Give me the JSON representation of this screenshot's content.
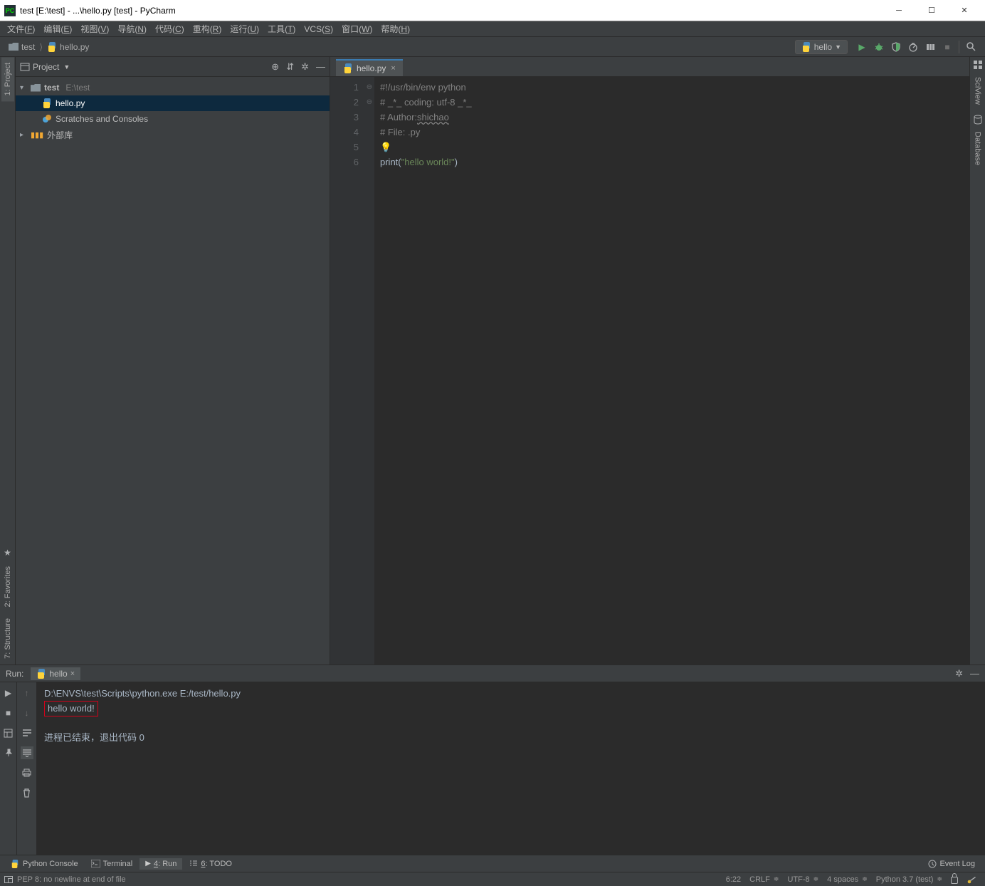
{
  "window": {
    "title": "test [E:\\test] - ...\\hello.py [test] - PyCharm"
  },
  "menubar": [
    "文件(F)",
    "编辑(E)",
    "视图(V)",
    "导航(N)",
    "代码(C)",
    "重构(R)",
    "运行(U)",
    "工具(T)",
    "VCS(S)",
    "窗口(W)",
    "帮助(H)"
  ],
  "breadcrumb": [
    {
      "icon": "folder",
      "label": "test"
    },
    {
      "icon": "python",
      "label": "hello.py"
    }
  ],
  "run_config": {
    "name": "hello"
  },
  "left_tabs": {
    "project": "1: Project"
  },
  "right_tabs": {
    "sciview": "SciView",
    "database": "Database"
  },
  "project": {
    "title": "Project",
    "tree": [
      {
        "level": 0,
        "arrow": "▾",
        "icon": "folder",
        "label": "test",
        "path": "E:\\test",
        "bold": true
      },
      {
        "level": 1,
        "arrow": "",
        "icon": "python",
        "label": "hello.py",
        "selected": true
      },
      {
        "level": 1,
        "arrow": "",
        "icon": "scratch",
        "label": "Scratches and Consoles"
      },
      {
        "level": 0,
        "arrow": "▸",
        "icon": "lib",
        "label": "外部库"
      }
    ]
  },
  "editor": {
    "tab_name": "hello.py",
    "lines": [
      {
        "n": "1",
        "fold": "⊖",
        "segs": [
          {
            "t": "#!/usr/bin/env python",
            "c": "c-cmt"
          }
        ]
      },
      {
        "n": "2",
        "fold": "",
        "segs": [
          {
            "t": "# _*_ coding: utf-8 _*_",
            "c": "c-cmt"
          }
        ]
      },
      {
        "n": "3",
        "fold": "",
        "segs": [
          {
            "t": "# Author:",
            "c": "c-cmt"
          },
          {
            "t": "shichao",
            "c": "c-cmt c-wavy"
          }
        ]
      },
      {
        "n": "4",
        "fold": "⊖",
        "segs": [
          {
            "t": "# File: .py",
            "c": "c-cmt"
          }
        ]
      },
      {
        "n": "5",
        "fold": "",
        "segs": [
          {
            "t": "💡",
            "c": "bulb"
          }
        ]
      },
      {
        "n": "6",
        "fold": "",
        "segs": [
          {
            "t": "print",
            "c": ""
          },
          {
            "t": "(",
            "c": ""
          },
          {
            "t": "\"hello world!\"",
            "c": "c-str"
          },
          {
            "t": ")",
            "c": ""
          }
        ]
      }
    ]
  },
  "run_tw": {
    "title": "Run:",
    "tab": "hello",
    "cmd": "D:\\ENVS\\test\\Scripts\\python.exe E:/test/hello.py",
    "output": "hello world!",
    "exit": "进程已结束，退出代码 0"
  },
  "bottom_bar": {
    "python_console": "Python Console",
    "terminal": "Terminal",
    "run": "4: Run",
    "todo": "6: TODO",
    "event_log": "Event Log"
  },
  "status": {
    "msg": "PEP 8: no newline at end of file",
    "pos": "6:22",
    "le": "CRLF",
    "enc": "UTF-8",
    "indent": "4 spaces",
    "interp": "Python 3.7 (test)"
  },
  "left_side": {
    "favorites": "2: Favorites",
    "structure": "7: Structure"
  }
}
